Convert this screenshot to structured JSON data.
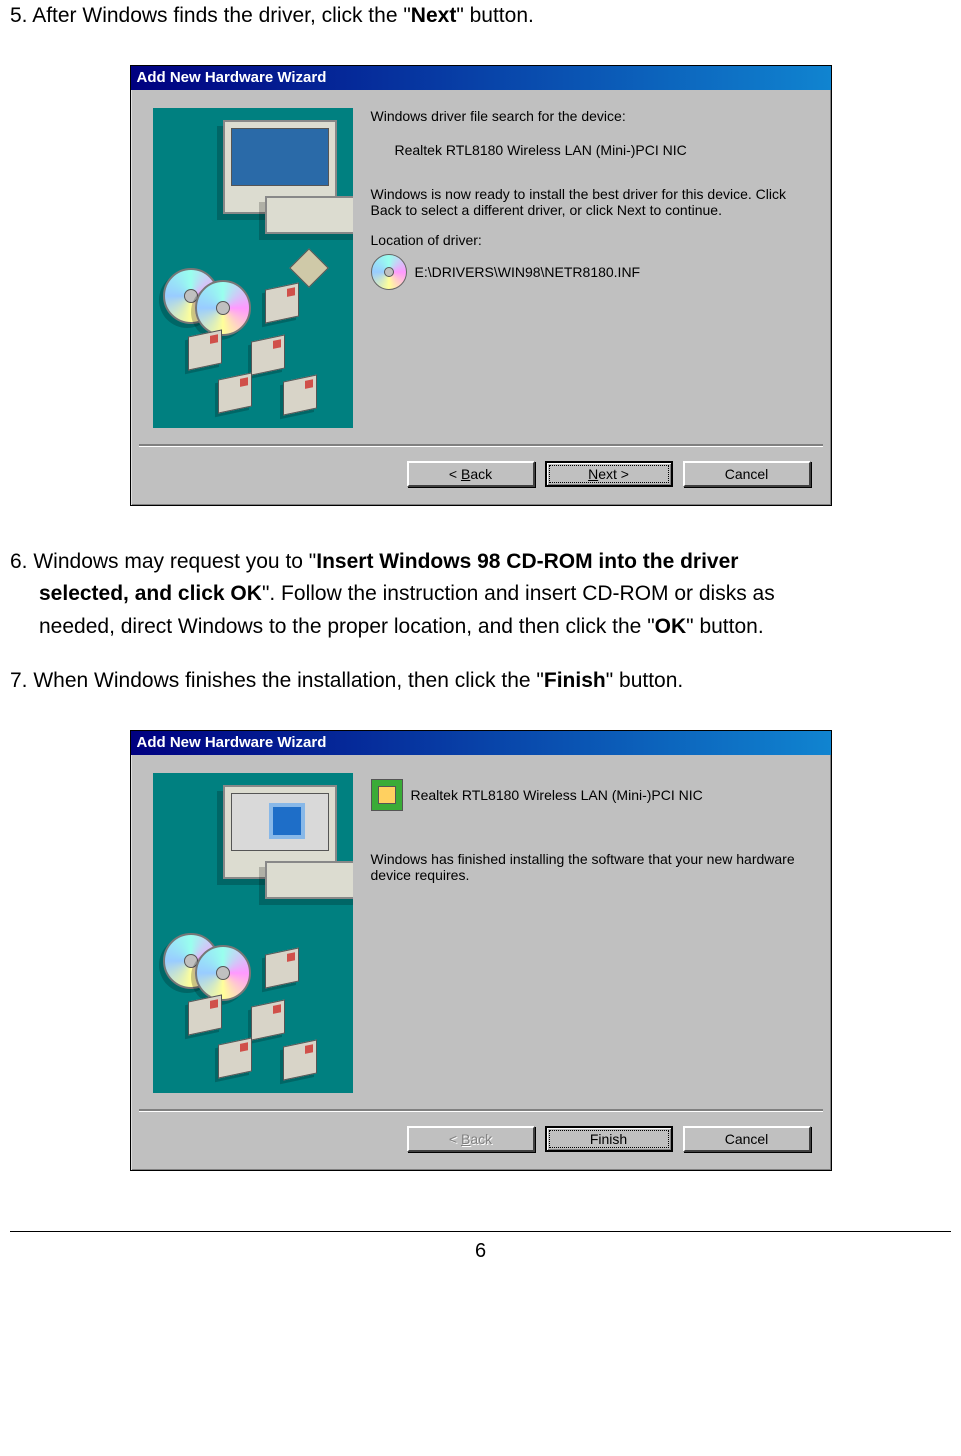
{
  "instructions": {
    "step5_pre": "5. After Windows finds the driver, click the \"",
    "step5_bold": "Next",
    "step5_post": "\" button.",
    "step6_a": "6. Windows may request you to \"",
    "step6_bold1": "Insert Windows 98 CD-ROM into the driver",
    "step6_bold2_line": "selected, and click OK",
    "step6_b": "\". Follow the instruction and insert CD-ROM or disks as",
    "step6_c": "needed, direct Windows to the proper location, and then click the \"",
    "step6_bold3": "OK",
    "step6_d": "\" button.",
    "step7_pre": "7. When Windows finishes the installation, then click the \"",
    "step7_bold": "Finish",
    "step7_post": "\" button."
  },
  "wizard1": {
    "title": "Add New Hardware Wizard",
    "line1": "Windows driver file search for the device:",
    "device": "Realtek RTL8180 Wireless LAN (Mini-)PCI NIC",
    "ready": "Windows is now ready to install the best driver for this device. Click Back to select a different driver, or click Next to continue.",
    "loc_label": "Location of driver:",
    "loc_path": "E:\\DRIVERS\\WIN98\\NETR8180.INF",
    "back": "< Back",
    "next": "Next >",
    "cancel": "Cancel"
  },
  "wizard2": {
    "title": "Add New Hardware Wizard",
    "device": "Realtek RTL8180 Wireless LAN (Mini-)PCI NIC",
    "finished": "Windows has finished installing the software that your new hardware device requires.",
    "back": "< Back",
    "finish": "Finish",
    "cancel": "Cancel"
  },
  "page_number": "6"
}
